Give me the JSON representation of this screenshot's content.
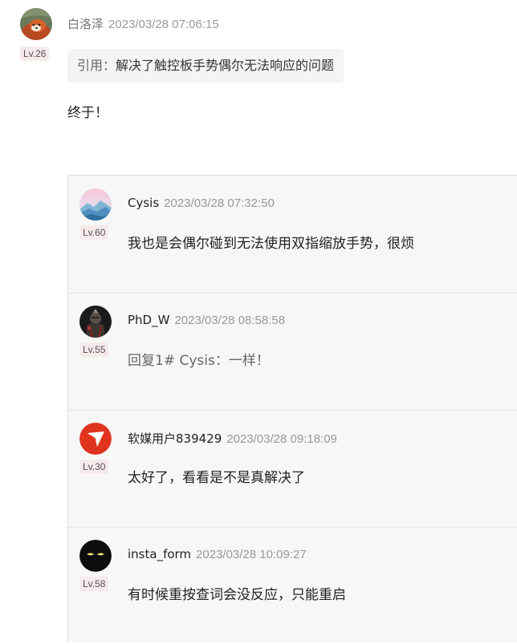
{
  "main_comment": {
    "username": "白洛泽",
    "timestamp": "2023/03/28 07:06:15",
    "level": "Lv.26",
    "quote_prefix": "引用：",
    "quote_text": "解决了触控板手势偶尔无法响应的问题",
    "body": "终于！"
  },
  "replies": [
    {
      "username": "Cysis",
      "timestamp": "2023/03/28 07:32:50",
      "level": "Lv.60",
      "body": "我也是会偶尔碰到无法使用双指缩放手势，很烦"
    },
    {
      "username": "PhD_W",
      "timestamp": "2023/03/28 08:58:58",
      "level": "Lv.55",
      "body": "回复1# Cysis：一样！"
    },
    {
      "username": "软媒用户839429",
      "timestamp": "2023/03/28 09:18:09",
      "level": "Lv.30",
      "body": "太好了，看看是不是真解决了"
    },
    {
      "username": "insta_form",
      "timestamp": "2023/03/28 10:09:27",
      "level": "Lv.58",
      "body": "有时候重按查词会没反应，只能重启"
    }
  ],
  "colors": {
    "badge_bg": "#f6eaea",
    "reply_bg": "#f7f7f7",
    "quote_bg": "#f4f4f4"
  }
}
